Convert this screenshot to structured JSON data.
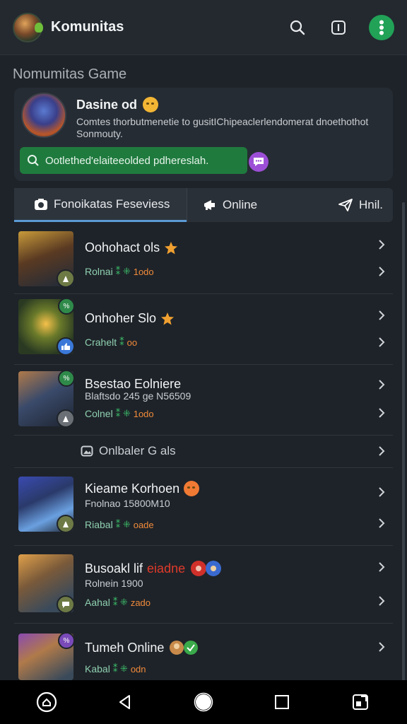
{
  "header": {
    "title": "Komunitas",
    "accent_color": "#21a257"
  },
  "section": {
    "title": "Nomumitas Game"
  },
  "post": {
    "author": "Dasine od",
    "text": "Comtes thorbutmenetie to gusitIChipeaclerlendomerat dnoethothot Sonmouty.",
    "banner_text": "Ootlethed'elaiteeolded pdhereslah."
  },
  "tabs": [
    {
      "label": "Fonoikatas Feseviess",
      "icon": "camera-icon",
      "active": true
    },
    {
      "label": "Online",
      "icon": "megaphone-icon",
      "active": false
    },
    {
      "label": "Hnil.",
      "icon": "send-icon",
      "active": false
    }
  ],
  "list": {
    "items": [
      {
        "title": "Oohohact ols",
        "status_label": "Rolnai",
        "status_time": "1odo"
      },
      {
        "title": "Onhoher Slo",
        "status_label": "Crahelt",
        "status_time": "oo"
      },
      {
        "title": "Bsestao Eolniere",
        "subtitle": "Blaftsdo 245 ge N56509",
        "status_label": "Colnel",
        "status_time": "1odo"
      },
      {
        "title": "Kieame Korhoen",
        "subtitle": "Fnolnao 15800M10",
        "status_label": "Riabal",
        "status_time": "oade"
      },
      {
        "title": "Busoakl lif",
        "title_highlight": "eiadne",
        "subtitle": "Rolnein 1900",
        "status_label": "Aahal",
        "status_time": "zado"
      },
      {
        "title": "Tumeh Online",
        "status_label": "Kabal",
        "status_time": "odn"
      }
    ],
    "group_label": "Onlbaler G als"
  },
  "navbar": {
    "icons": [
      "home-icon",
      "back-icon",
      "home-circle-icon",
      "recents-icon",
      "apps-icon"
    ]
  }
}
